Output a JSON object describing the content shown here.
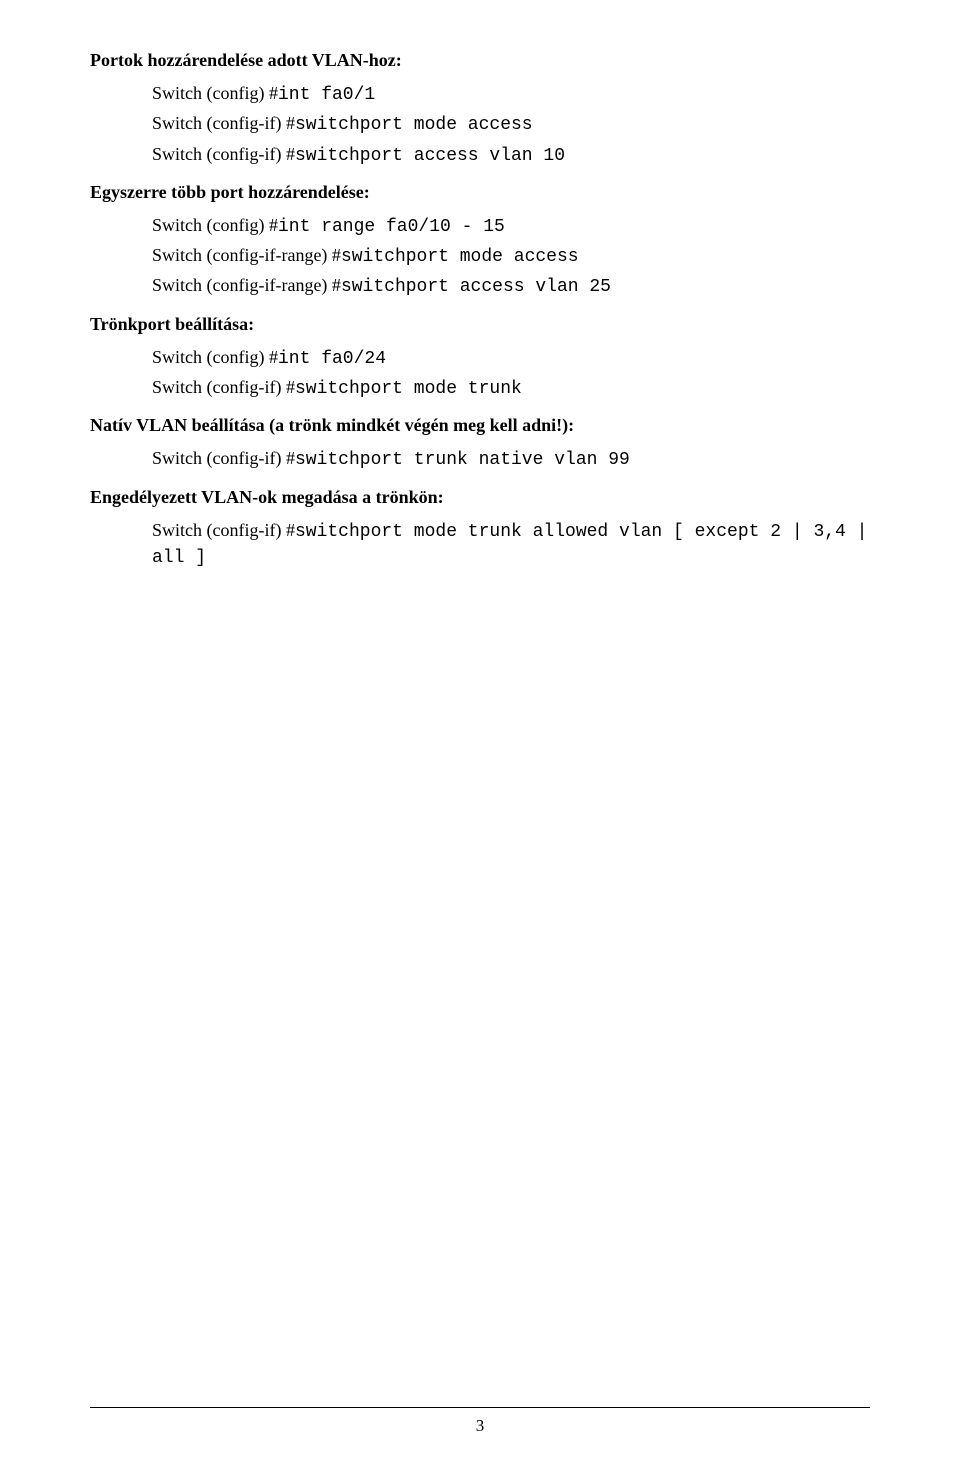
{
  "sections": [
    {
      "heading": "Portok hozzárendelése adott VLAN-hoz:",
      "lines": [
        {
          "prefix": "Switch (config) #",
          "cmd": "int fa0/1"
        },
        {
          "prefix": "Switch (config-if) #",
          "cmd": "switchport mode access"
        },
        {
          "prefix": "Switch (config-if) #",
          "cmd": "switchport access vlan 10"
        }
      ]
    },
    {
      "heading": "Egyszerre több port hozzárendelése:",
      "lines": [
        {
          "prefix": "Switch (config) #",
          "cmd": "int range fa0/10 - 15"
        },
        {
          "prefix": "Switch (config-if-range) #",
          "cmd": "switchport mode access"
        },
        {
          "prefix": "Switch (config-if-range) #",
          "cmd": "switchport access vlan 25"
        }
      ]
    },
    {
      "heading": "Trönkport beállítása:",
      "lines": [
        {
          "prefix": "Switch (config) #",
          "cmd": "int fa0/24"
        },
        {
          "prefix": "Switch (config-if) #",
          "cmd": "switchport mode trunk"
        }
      ]
    },
    {
      "heading": "Natív VLAN beállítása (a trönk mindkét végén meg kell adni!):",
      "lines": [
        {
          "prefix": "Switch (config-if) #",
          "cmd": "switchport trunk native vlan 99"
        }
      ]
    },
    {
      "heading": "Engedélyezett VLAN-ok megadása a trönkön:",
      "lines": [
        {
          "prefix": "Switch (config-if) #",
          "cmd": "switchport mode trunk allowed vlan [ except 2 | 3,4 | all ]"
        }
      ]
    }
  ],
  "page_number": "3"
}
